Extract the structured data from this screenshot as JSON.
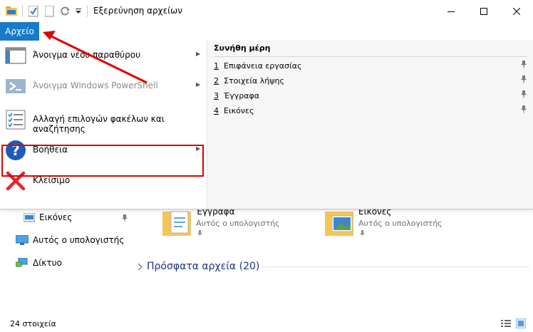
{
  "window": {
    "title": "Εξερεύνηση αρχείων",
    "minimize_glyph": "—",
    "maximize_glyph": "☐",
    "close_glyph": "✕"
  },
  "ribbon": {
    "file_tab": "Αρχείο"
  },
  "file_menu": {
    "items": [
      {
        "label": "Άνοιγμα νέου παραθύρου",
        "icon": "new-window-icon",
        "has_submenu": true,
        "enabled": true
      },
      {
        "label": "Άνοιγμα Windows PowerShell",
        "icon": "powershell-icon",
        "has_submenu": true,
        "enabled": false
      },
      {
        "label": "Αλλαγή επιλογών φακέλων και αναζήτησης",
        "icon": "folder-options-icon",
        "has_submenu": false,
        "enabled": true
      },
      {
        "label": "Βοήθεια",
        "icon": "help-icon",
        "has_submenu": true,
        "enabled": true
      },
      {
        "label": "Κλείσιμο",
        "icon": "close-x-icon",
        "has_submenu": false,
        "enabled": true
      }
    ],
    "frequent_places": {
      "title": "Συνήθη μέρη",
      "items": [
        {
          "num": "1",
          "label": "Επιφάνεια εργασίας"
        },
        {
          "num": "2",
          "label": "Στοιχεία λήψης"
        },
        {
          "num": "3",
          "label": "Έγγραφα"
        },
        {
          "num": "4",
          "label": "Εικόνες"
        }
      ]
    }
  },
  "nav_pane": {
    "items": [
      {
        "label": "Εικόνες",
        "icon": "pictures-icon"
      },
      {
        "label": "Αυτός ο υπολογιστής",
        "icon": "computer-icon"
      },
      {
        "label": "Δίκτυο",
        "icon": "network-icon"
      }
    ]
  },
  "quick_access": {
    "folders": [
      {
        "name": "Έγγραφα",
        "location": "Αυτός ο υπολογιστής"
      },
      {
        "name": "Εικόνες",
        "location": "Αυτός ο υπολογιστής"
      }
    ],
    "recent_header": "Πρόσφατα αρχεία (20)"
  },
  "status": {
    "item_count": "24 στοιχεία"
  },
  "colors": {
    "accent": "#1979ca",
    "highlight": "#e00000",
    "folder": "#f3c659"
  }
}
